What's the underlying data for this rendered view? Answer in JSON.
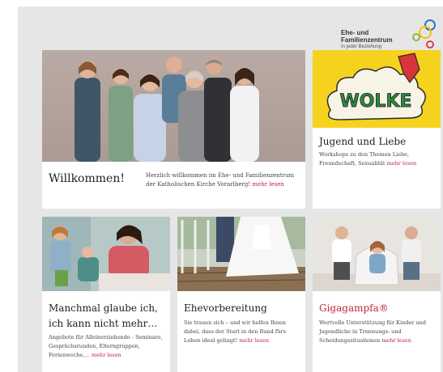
{
  "logo": {
    "line1": "Ehe- und",
    "line2": "Familienzentrum",
    "tagline": "In jeder Beziehung"
  },
  "welcome": {
    "title": "Willkommen!",
    "text": "Herzlich willkommen im Ehe- und Familienzentrum der Katholischen Kirche Vorarlberg!",
    "more": "mehr lesen"
  },
  "jugend": {
    "title": "Jugend und Liebe",
    "text": "Workshops zu den Themen Liebe, Freundschaft, Sexualität",
    "more": "mehr lesen",
    "poster": "WOLKE"
  },
  "manchmal": {
    "title": "Manchmal glaube ich, ich kann nicht mehr…",
    "text": "Angebote für Alleinerziehende - Seminare, Gesprächsrunden, Elterngruppen, Ferienwoche,…",
    "more": "mehr lesen"
  },
  "ehe": {
    "title": "Ehevorbereitung",
    "text": "Sie trauen sich – und wir helfen Ihnen dabei, dass der Start in den Bund fürs Leben ideal gelingt!",
    "more": "mehr lesen"
  },
  "giga": {
    "title": "Gigagampfa®",
    "text": "Wertvolle Unterstützung für Kinder und Jugendliche in Trennungs- und Scheidungssituationen",
    "more": "mehr lesen"
  },
  "colors": {
    "accent": "#c0243c",
    "page_bg": "#e6e6e6",
    "poster_yellow": "#f5d21e"
  }
}
